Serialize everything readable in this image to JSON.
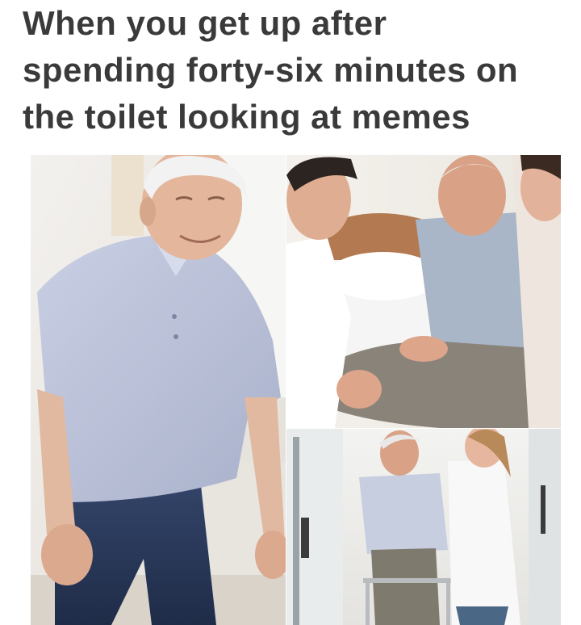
{
  "caption": {
    "lines": [
      "When you get up after",
      "spending forty-six minutes on",
      "the toilet looking at memes"
    ]
  },
  "panels": [
    {
      "subject": "elderly man in light blue polo rising from a low seat, hands on knees"
    },
    {
      "subject": "two caregivers helping an elderly man sitting on a bed"
    },
    {
      "subject": "elderly man walking with a walker beside a nurse"
    }
  ]
}
